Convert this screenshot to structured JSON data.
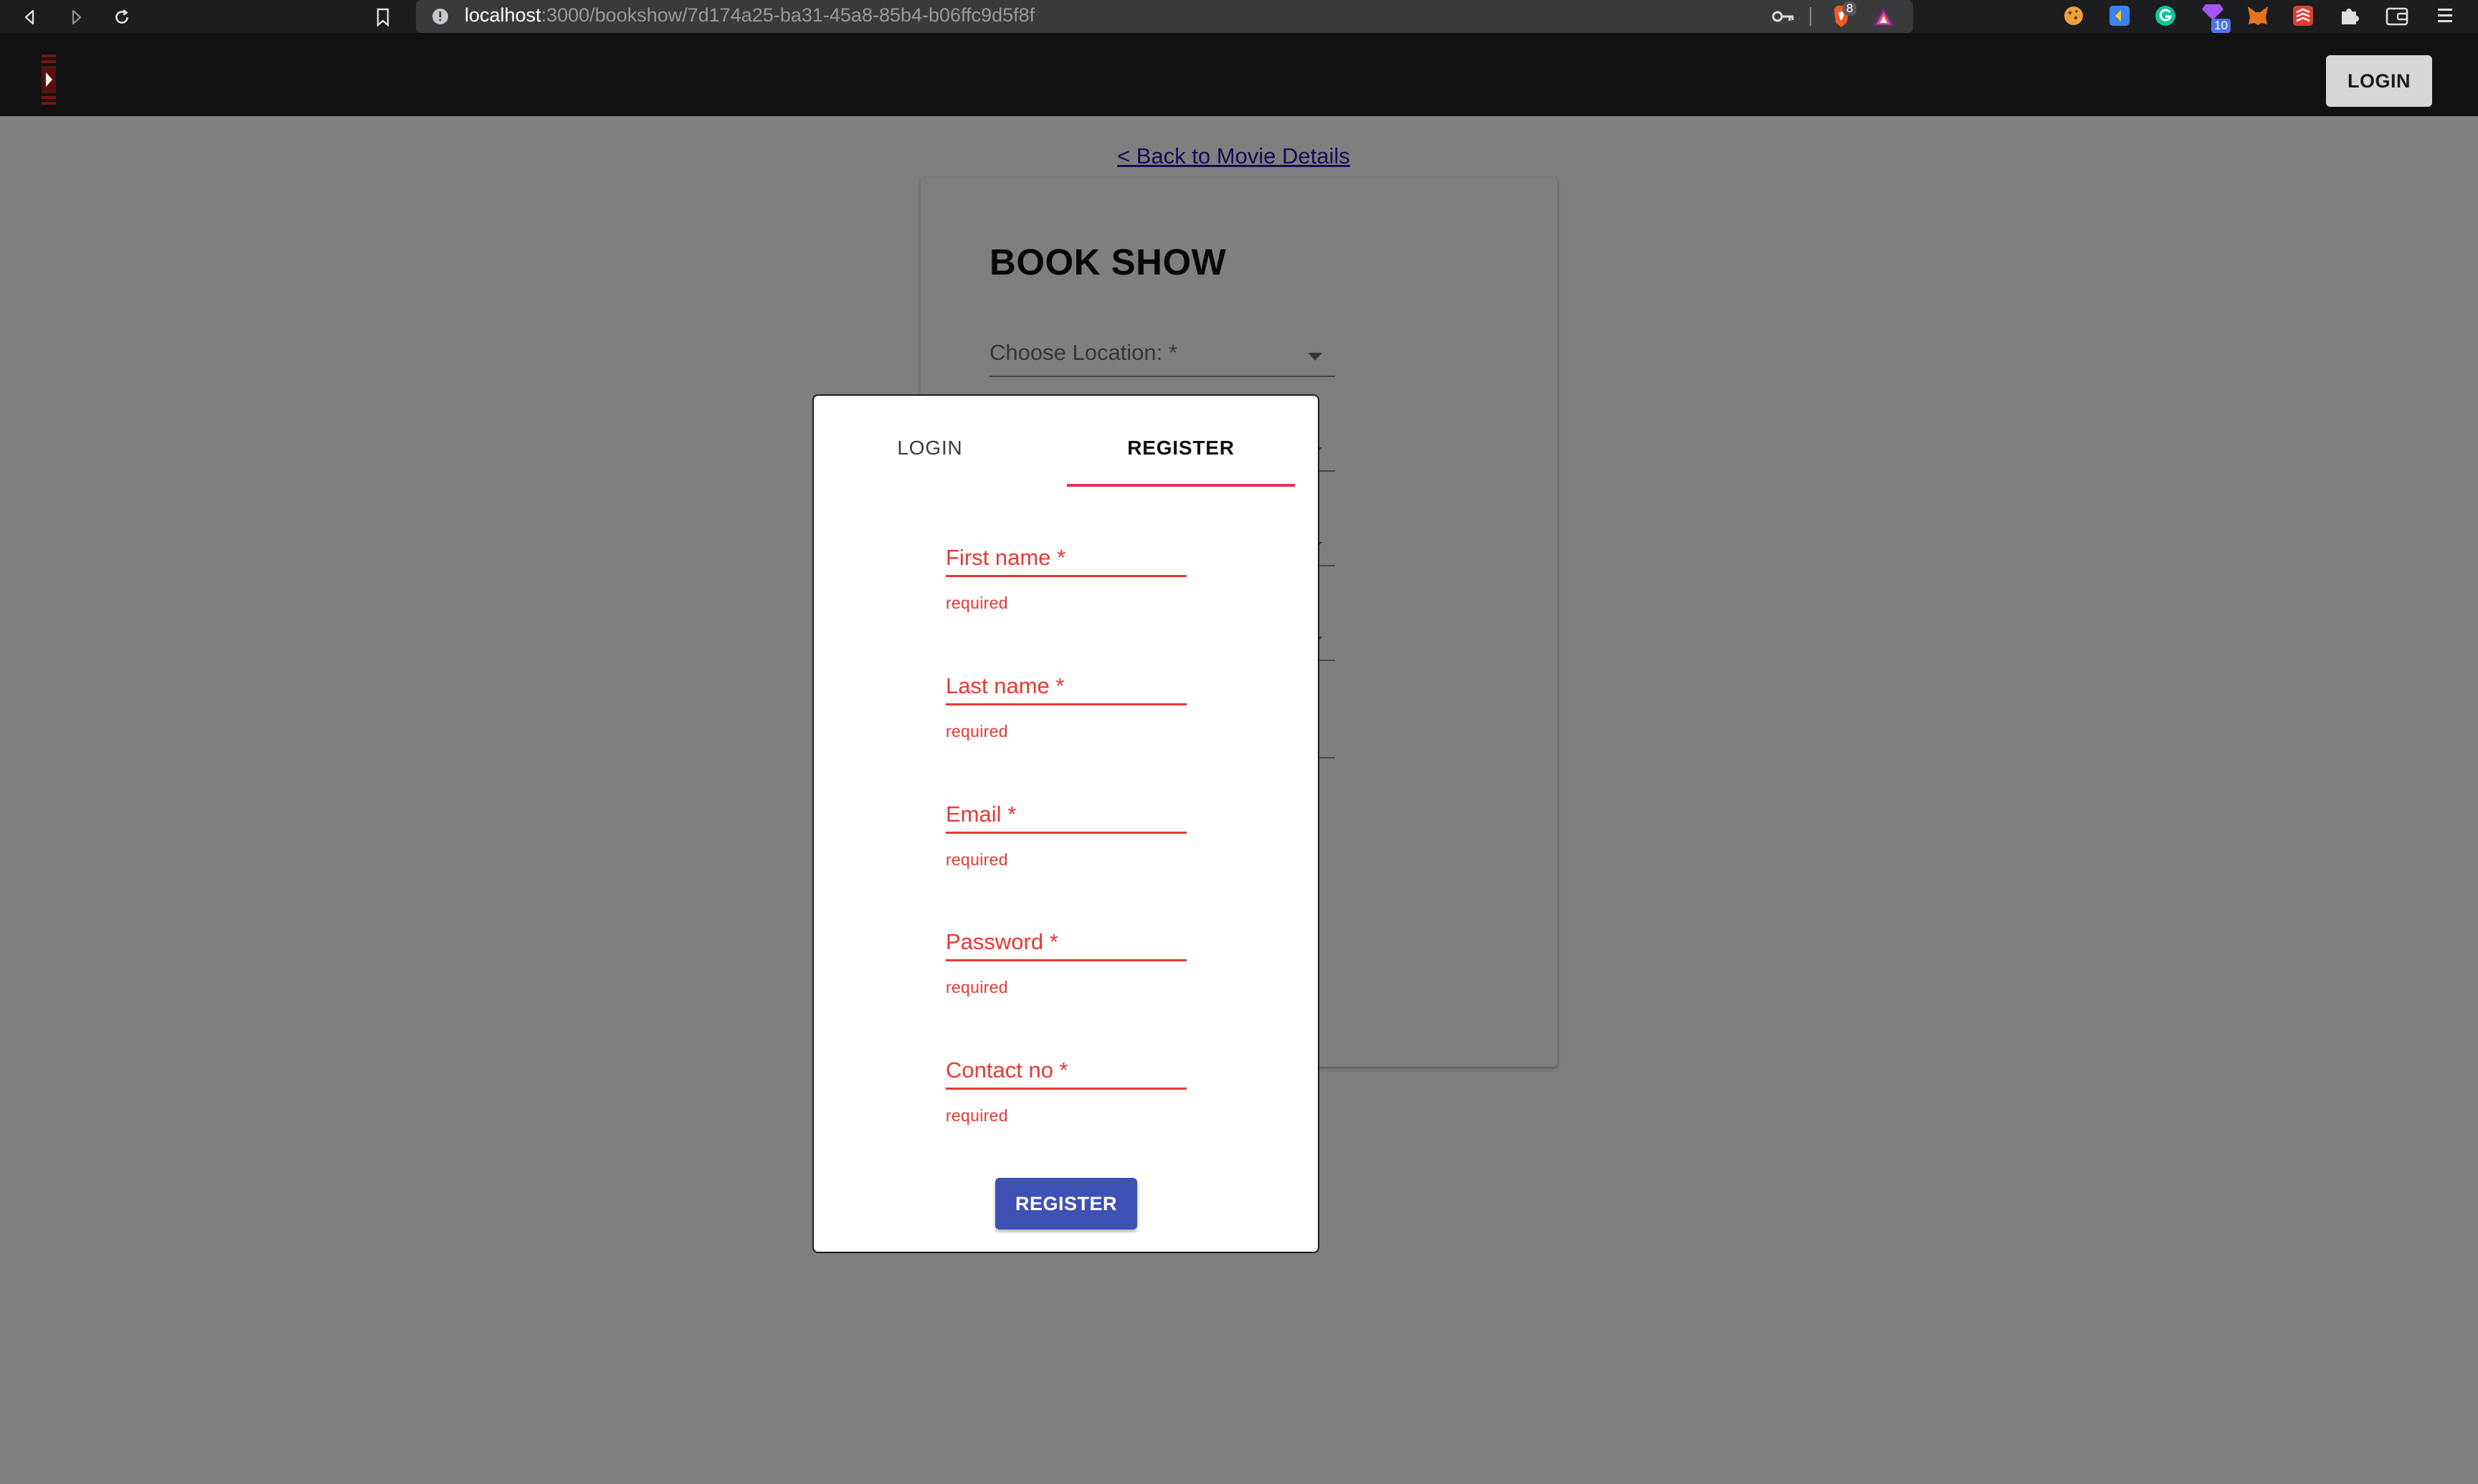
{
  "browser": {
    "url_host": "localhost",
    "url_path": ":3000/bookshow/7d174a25-ba31-45a8-85b4-b06ffc9d5f8f",
    "brave_badge": "8",
    "ext_badge": "10",
    "icons": [
      "back-icon",
      "forward-icon",
      "reload-icon",
      "bookmark-icon",
      "info-icon",
      "key-icon",
      "brave-shield-icon",
      "brave-rewards-icon",
      "cookie-icon",
      "extension-icon",
      "puzzle-icon",
      "wallet-icon",
      "menu-icon"
    ]
  },
  "header": {
    "login_label": "LOGIN"
  },
  "page": {
    "back_link": "< Back to Movie Details",
    "title": "BOOK SHOW",
    "choose_location": "Choose Location: *"
  },
  "modal": {
    "tabs": [
      {
        "label": "LOGIN",
        "active": false
      },
      {
        "label": "REGISTER",
        "active": true
      }
    ],
    "fields": [
      {
        "label": "First name *",
        "helper": "required"
      },
      {
        "label": "Last name *",
        "helper": "required"
      },
      {
        "label": "Email *",
        "helper": "required"
      },
      {
        "label": "Password *",
        "helper": "required"
      },
      {
        "label": "Contact no *",
        "helper": "required"
      }
    ],
    "submit_label": "REGISTER"
  },
  "colors": {
    "accent_tab": "#e8305b",
    "error": "#e53935",
    "primary": "#3f51b5"
  }
}
